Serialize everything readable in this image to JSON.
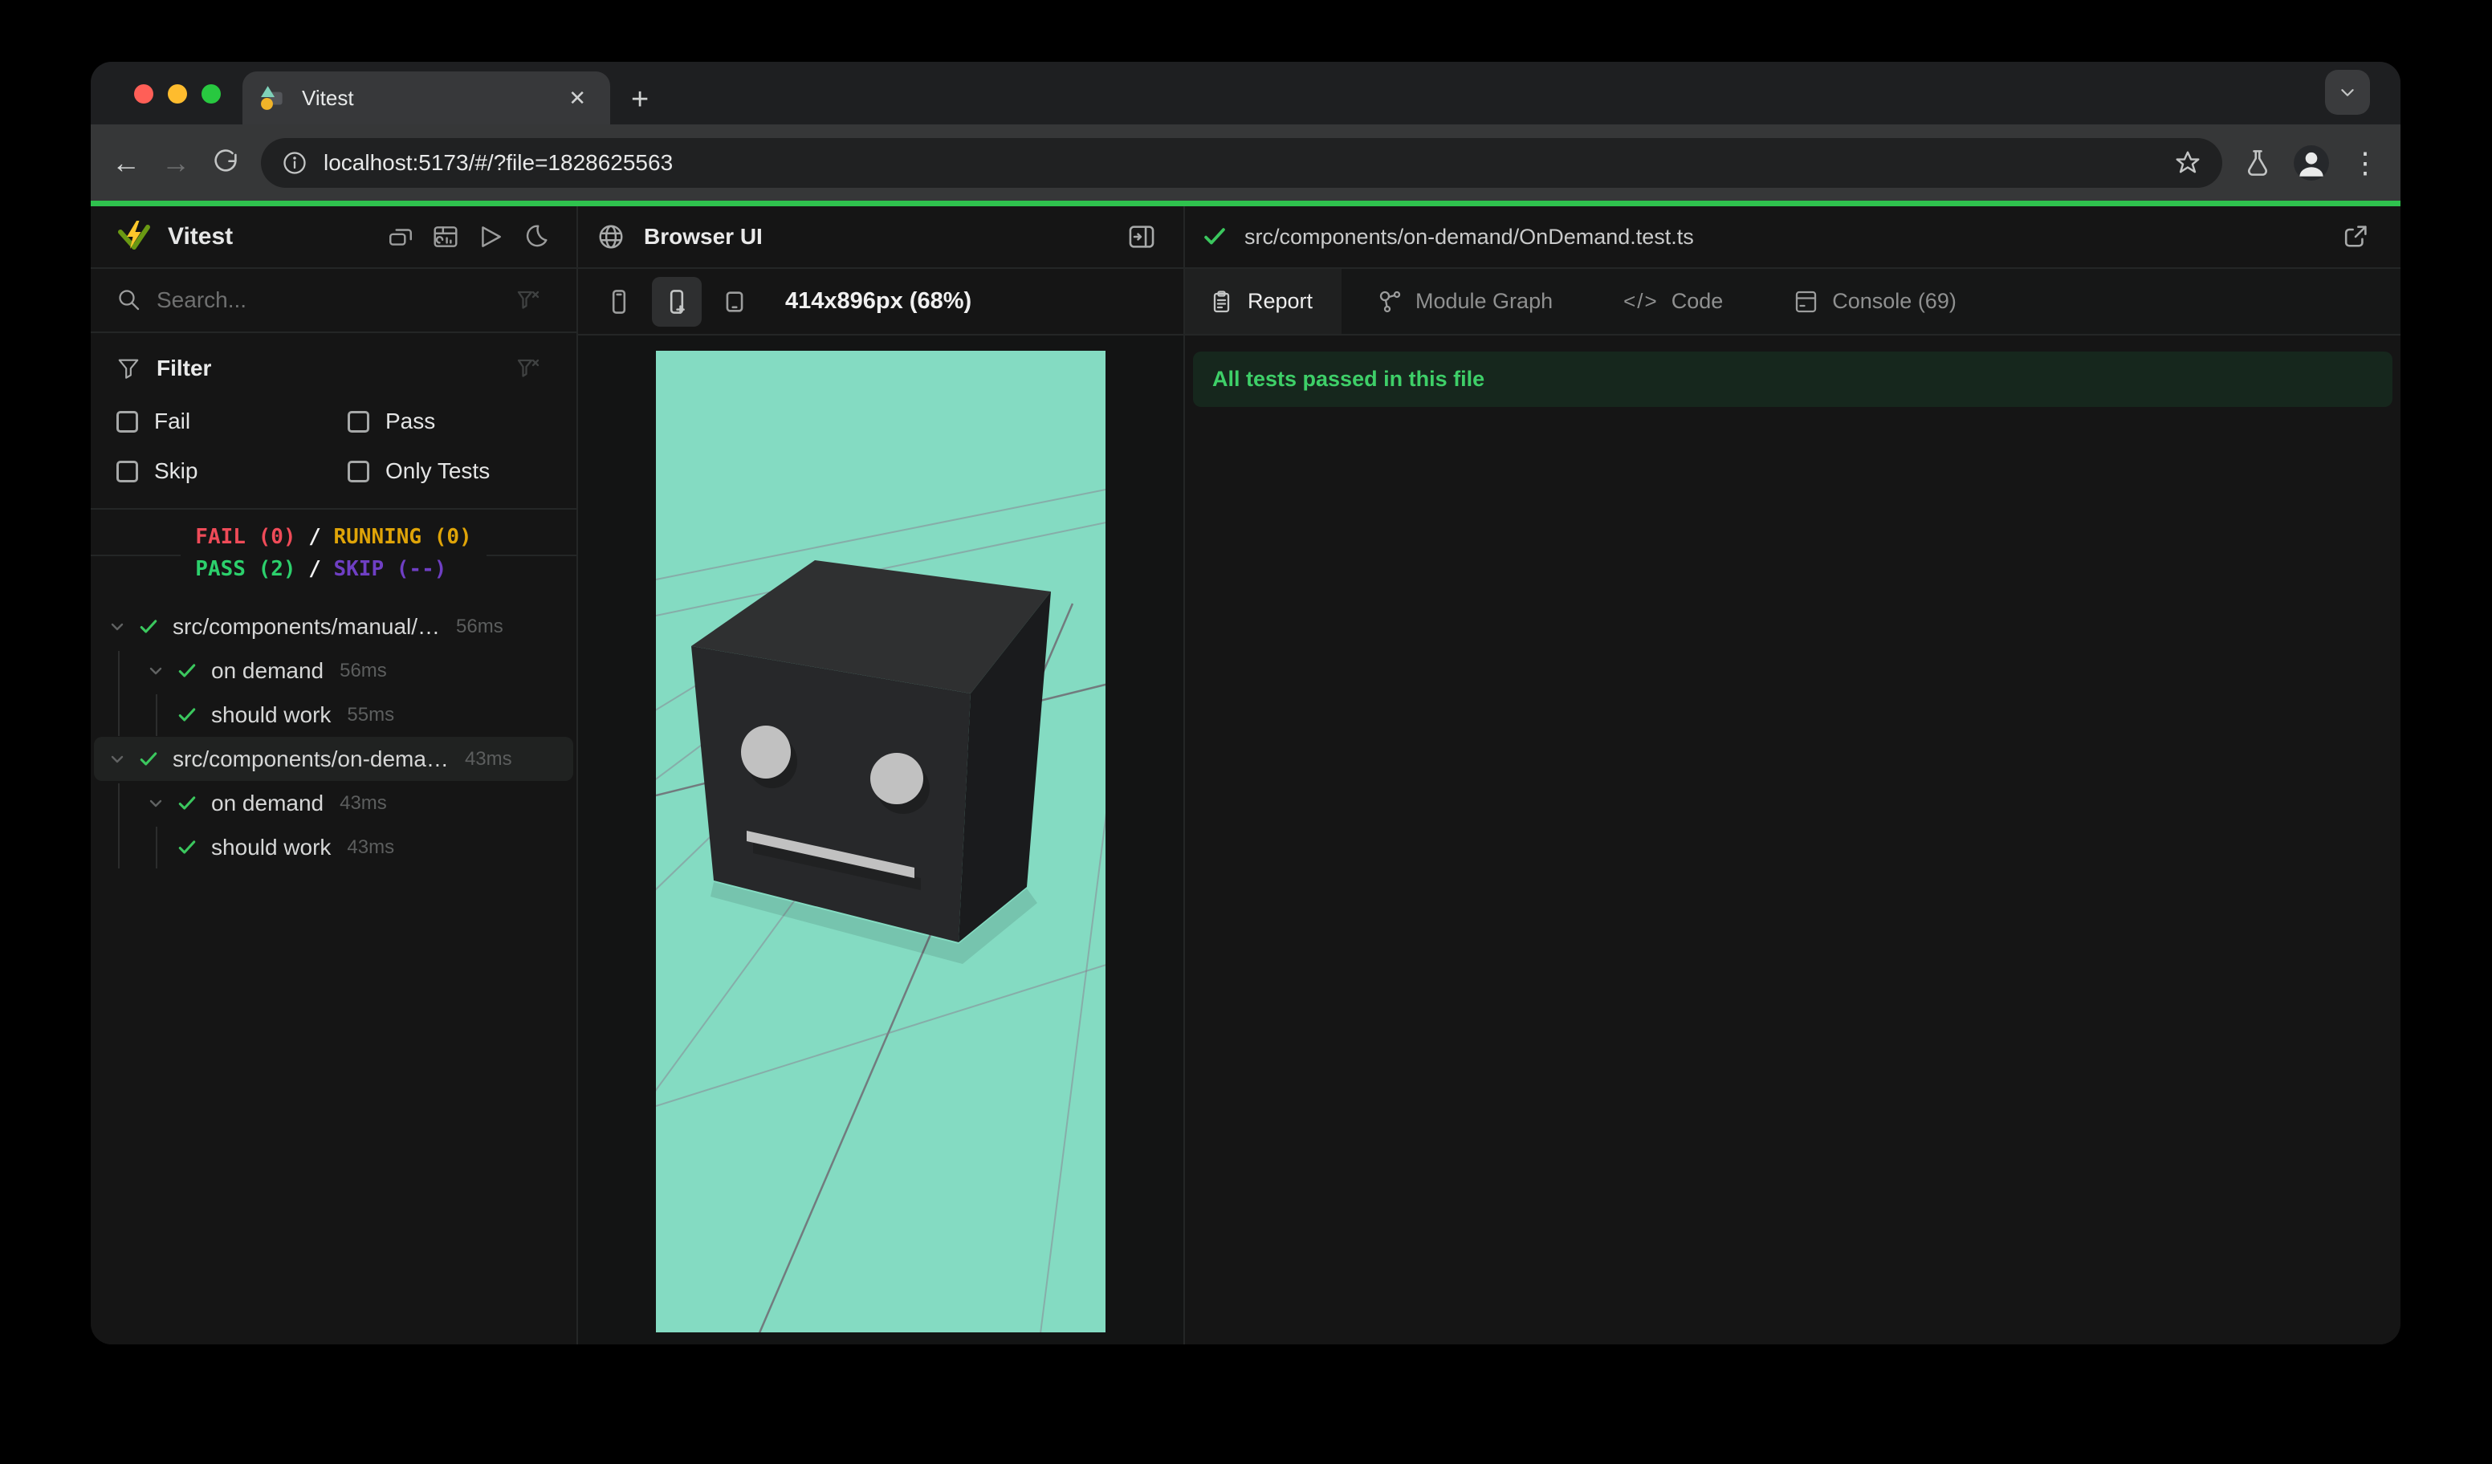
{
  "browser": {
    "tab_title": "Vitest",
    "close_glyph": "✕",
    "new_tab_glyph": "+",
    "back_glyph": "←",
    "forward_glyph": "→",
    "url": "localhost:5173/#/?file=1828625563",
    "kebab_glyph": "⋮"
  },
  "sidebar": {
    "title": "Vitest",
    "search_placeholder": "Search...",
    "filter": {
      "label": "Filter",
      "options": [
        {
          "label": "Fail"
        },
        {
          "label": "Pass"
        },
        {
          "label": "Skip"
        },
        {
          "label": "Only Tests"
        }
      ]
    },
    "summary": {
      "fail": "FAIL (0)",
      "running": "RUNNING (0)",
      "pass": "PASS (2)",
      "skip": "SKIP (--)",
      "sep": "/"
    },
    "tree": [
      {
        "name": "src/components/manual/…",
        "duration": "56ms",
        "level": 0,
        "expanded": true,
        "selected": false
      },
      {
        "name": "on demand",
        "duration": "56ms",
        "level": 1,
        "expanded": true,
        "selected": false
      },
      {
        "name": "should work",
        "duration": "55ms",
        "level": 2,
        "expanded": false,
        "selected": false
      },
      {
        "name": "src/components/on-dema…",
        "duration": "43ms",
        "level": 0,
        "expanded": true,
        "selected": true
      },
      {
        "name": "on demand",
        "duration": "43ms",
        "level": 1,
        "expanded": true,
        "selected": false
      },
      {
        "name": "should work",
        "duration": "43ms",
        "level": 2,
        "expanded": false,
        "selected": false
      }
    ]
  },
  "preview": {
    "title": "Browser UI",
    "size_label": "414x896px (68%)"
  },
  "results": {
    "file_path": "src/components/on-demand/OnDemand.test.ts",
    "tabs": [
      {
        "label": "Report",
        "active": true
      },
      {
        "label": "Module Graph",
        "active": false
      },
      {
        "label": "Code",
        "active": false,
        "icon_glyph": "</>"
      },
      {
        "label": "Console (69)",
        "active": false
      }
    ],
    "banner": "All tests passed in this file"
  },
  "colors": {
    "accent_green": "#2fc24e",
    "pass_green": "#3bc75e",
    "fail_red": "#ef4b58",
    "running_yellow": "#dfa408",
    "skip_purple": "#6f3fc4",
    "viewport_background": "#84dbc2"
  }
}
